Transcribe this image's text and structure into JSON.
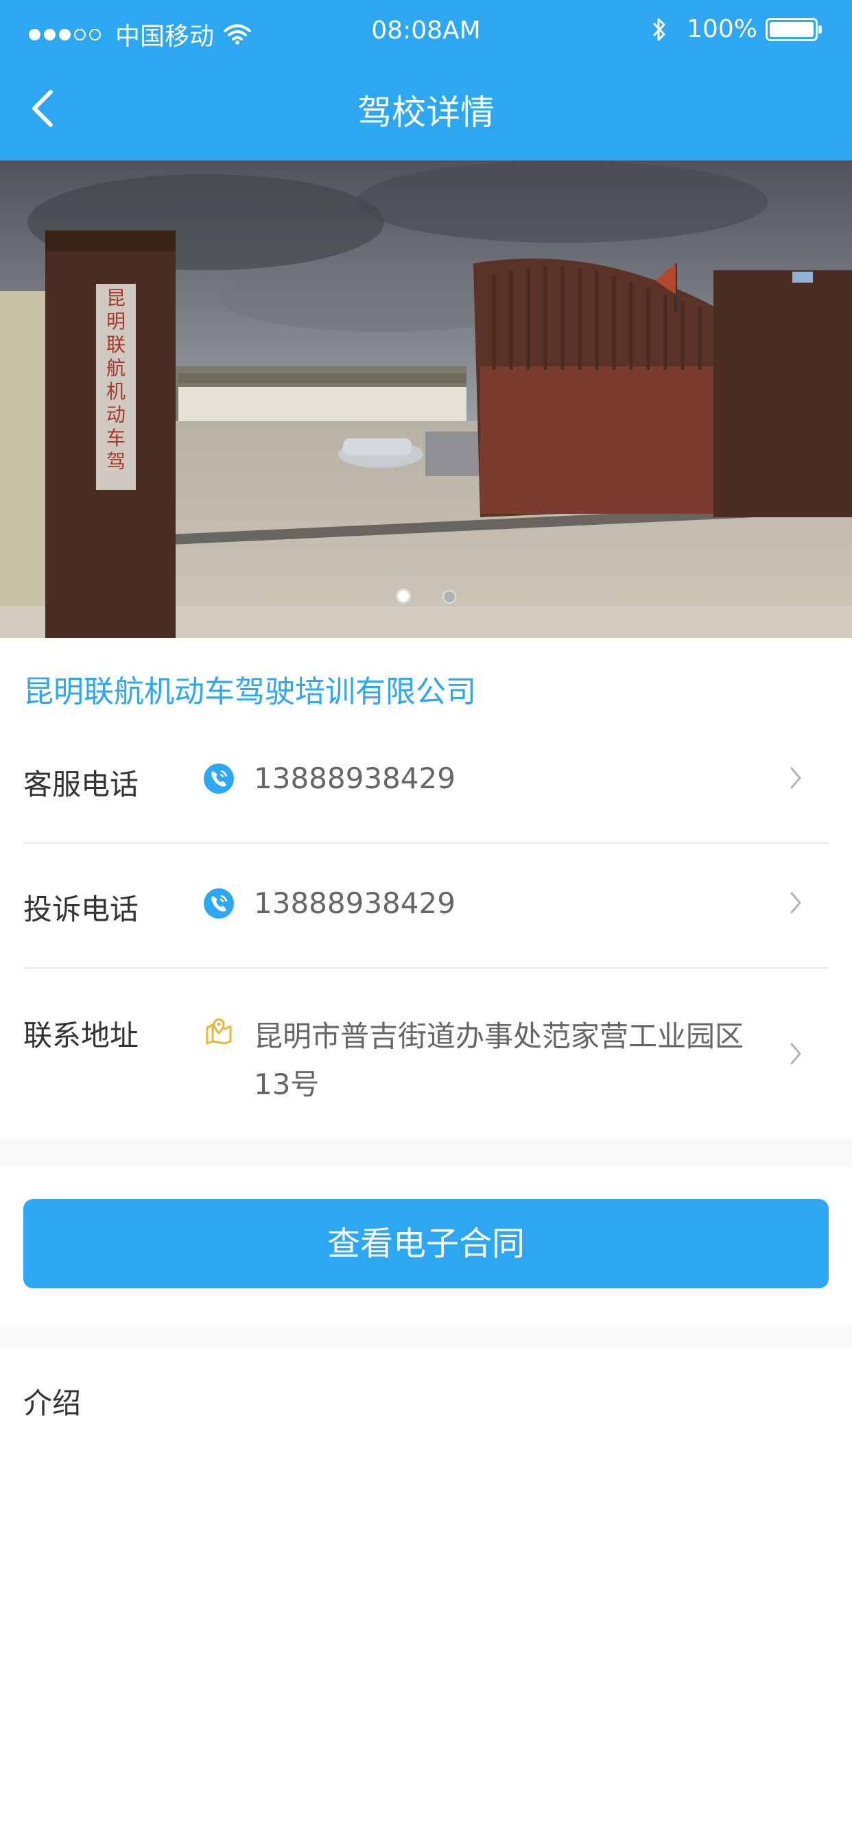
{
  "status_bar": {
    "carrier": "中国移动",
    "time": "08:08AM",
    "battery": "100%"
  },
  "nav": {
    "title": "驾校详情"
  },
  "banner": {
    "sign_text": "昆明联航机动车驾驶培训有限公司",
    "slides": 2,
    "active_slide": 1
  },
  "school": {
    "name": "昆明联航机动车驾驶培训有限公司"
  },
  "rows": [
    {
      "label": "客服电话",
      "value": "13888938429",
      "icon": "phone-icon"
    },
    {
      "label": "投诉电话",
      "value": "13888938429",
      "icon": "phone-icon"
    },
    {
      "label": "联系地址",
      "value_line1": "昆明市普吉街道办事处范家营工业园区",
      "value_line2": "13号",
      "icon": "map-location-icon"
    }
  ],
  "contract_button": {
    "label": "查看电子合同"
  },
  "intro": {
    "title": "介绍"
  },
  "colors": {
    "primary": "#2ea7f2",
    "address_icon": "#e8b63a",
    "text": "#333333",
    "subtext": "#666666"
  }
}
